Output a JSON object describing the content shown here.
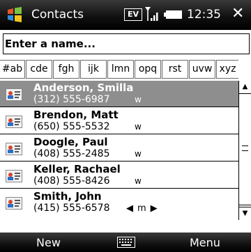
{
  "title_bar": {
    "app_title": "Contacts",
    "ev_badge": "EV",
    "time": "12:35",
    "close_glyph": "✕",
    "icons": [
      "windows-start-icon",
      "signal-icon",
      "battery-icon"
    ]
  },
  "search": {
    "placeholder": "Enter a name..."
  },
  "tabs": [
    {
      "label": "#ab"
    },
    {
      "label": "cde"
    },
    {
      "label": "fgh"
    },
    {
      "label": "ijk"
    },
    {
      "label": "lmn"
    },
    {
      "label": "opq"
    },
    {
      "label": "rst"
    },
    {
      "label": "uvw"
    },
    {
      "label": "xyz"
    }
  ],
  "contacts": [
    {
      "name": "Anderson, Smilla",
      "number": "(312) 555-6987",
      "type": "w",
      "selected": true
    },
    {
      "name": "Brendon, Matt",
      "number": "(650) 555-5532",
      "type": "w",
      "selected": false
    },
    {
      "name": "Doogle, Paul",
      "number": "(408) 555-2485",
      "type": "w",
      "selected": false
    },
    {
      "name": "Keller, Rachael",
      "number": "(408) 555-8426",
      "type": "w",
      "selected": false
    },
    {
      "name": "Smith, John",
      "number": "(415) 555-6578",
      "type": "m",
      "selected": false
    }
  ],
  "last_row_nav": {
    "left": "◀",
    "right": "▶"
  },
  "menu_bar": {
    "left_soft_key": "New",
    "right_soft_key": "Menu",
    "center_icon": "keyboard-icon"
  },
  "colors": {
    "title_bar": "#000000",
    "selected_row": "#8e8e8e",
    "text": "#000000"
  }
}
